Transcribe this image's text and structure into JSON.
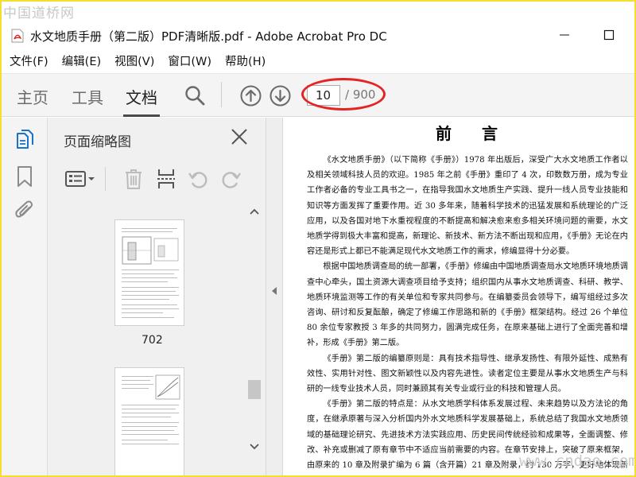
{
  "watermark_top": "中国道桥网",
  "watermark_bottom": "www.cndao.com",
  "window": {
    "title": "水文地质手册（第二版）PDF清晰版.pdf - Adobe Acrobat Pro DC"
  },
  "menu": [
    "文件(F)",
    "编辑(E)",
    "视图(V)",
    "窗口(W)",
    "帮助(H)"
  ],
  "tabs": [
    "主页",
    "工具",
    "文档"
  ],
  "active_tab": "文档",
  "page_nav": {
    "current": "10",
    "total": "/ 900"
  },
  "panel": {
    "title": "页面缩略图",
    "thumbnails": [
      {
        "label": "702"
      }
    ]
  },
  "document": {
    "heading": "前言",
    "paragraphs": [
      "《水文地质手册》（以下简称《手册》）1978 年出版后，深受广大水文地质工作者以及相关领域科技人员的欢迎。1985 年之前《手册》重印了 4 次，印数数万册，成为专业工作者必备的专业工具书之一，在指导我国水文地质生产实践、提升一线人员专业技能和知识等方面发挥了重要作用。近 30 多年来，随着科学技术的迅猛发展和系统理论的广泛应用，以及各国对地下水重视程度的不断提高和解决愈来愈多相关环境问题的需要，水文地质学得到极大丰富和提高，新理论、新技术、新方法不断出现和应用，《手册》无论在内容还是形式上都已不能满足现代水文地质工作的需求，修编显得十分必要。",
      "根据中国地质调查局的统一部署，《手册》修编由中国地质调查局水文地质环境地质调查中心牵头，国土资源大调查项目给予支持；组织国内从事水文地质调查、科研、教学、地质环境监测等工作的有关单位和专家共同参与。在编纂委员会领导下，编写组经过多次咨询、研讨和反复酝酿，确定了修编工作思路和新的《手册》框架结构。经过 26 个单位 80 余位专家教授 3 年多的共同努力，圆满完成任务，在原来基础上进行了全面完善和增补，形成《手册》第二版。",
      "《手册》第二版的编纂原则是：具有技术指导性、继承发扬性、有限外延性、成熟有效性、实用针对性、图文新颖性以及内容先进性。读者定位主要是从事水文地质生产与科研的一线专业技术人员，同时兼顾其有关专业或行业的科技和管理人员。",
      "《手册》第二版的特点是：从水文地质学科体系发展过程、未来趋势以及方法论的角度，在继承原著与深入分析国内外水文地质科学发展基础上，系统总结了我国水文地质领域的基础理论研究、先进技术方法实践应用、历史民间传统经验和成果等，全面调整、修改、补充或删减了原有章节中不适应当前需要的内容。在章节安排上，突破了原来框架，由原来的 10 章及附录扩编为 6 篇（含开篇）21 章及附录，约 130 万字，更好地体现新时期水文地质工作的特点。"
    ]
  }
}
